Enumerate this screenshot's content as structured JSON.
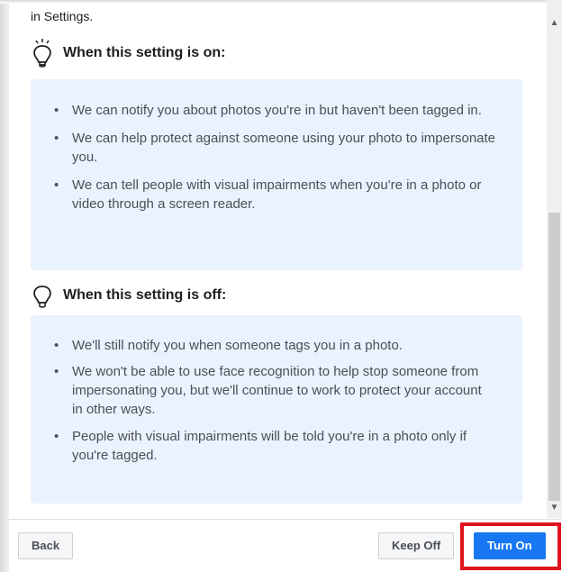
{
  "dialog": {
    "cut_text": "in Settings.",
    "on_section": {
      "heading": "When this setting is on:",
      "items": [
        "We can notify you about photos you're in but haven't been tagged in.",
        "We can help protect against someone using your photo to impersonate you.",
        "We can tell people with visual impairments when you're in a photo or video through a screen reader."
      ]
    },
    "off_section": {
      "heading": "When this setting is off:",
      "items": [
        "We'll still notify you when someone tags you in a photo.",
        "We won't be able to use face recognition to help stop someone from impersonating you, but we'll continue to work to protect your account in other ways.",
        "People with visual impairments will be told you're in a photo only if you're tagged."
      ]
    }
  },
  "footer": {
    "back_label": "Back",
    "keep_off_label": "Keep Off",
    "turn_on_label": "Turn On"
  },
  "colors": {
    "panel_bg": "#eaf2fd",
    "primary": "#1877f2",
    "highlight": "#e0141e"
  },
  "icons": {
    "on_icon": "lightbulb-on-icon",
    "off_icon": "lightbulb-off-icon"
  }
}
